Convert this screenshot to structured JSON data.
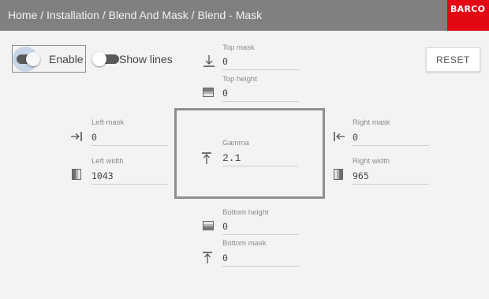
{
  "header": {
    "breadcrumb": "Home / Installation / Blend And Mask / Blend - Mask",
    "logo": "BARCO",
    "bg_color": "#808080",
    "logo_color": "#e30613"
  },
  "controls": {
    "enable_label": "Enable",
    "enable_on": true,
    "show_lines_label": "Show lines",
    "show_lines_on": false,
    "reset_label": "RESET"
  },
  "fields": {
    "top_mask": {
      "label": "Top mask",
      "value": "0",
      "icon": "top-mask-icon"
    },
    "top_height": {
      "label": "Top height",
      "value": "0",
      "icon": "top-height-icon"
    },
    "left_mask": {
      "label": "Left mask",
      "value": "0",
      "icon": "left-mask-icon"
    },
    "left_width": {
      "label": "Left width",
      "value": "1043",
      "icon": "left-width-icon"
    },
    "gamma": {
      "label": "Gamma",
      "value": "2.1",
      "icon": "gamma-icon"
    },
    "right_mask": {
      "label": "Right mask",
      "value": "0",
      "icon": "right-mask-icon"
    },
    "right_width": {
      "label": "Right width",
      "value": "965",
      "icon": "right-width-icon"
    },
    "bottom_height": {
      "label": "Bottom height",
      "value": "0",
      "icon": "bottom-height-icon"
    },
    "bottom_mask": {
      "label": "Bottom mask",
      "value": "0",
      "icon": "bottom-mask-icon"
    }
  }
}
